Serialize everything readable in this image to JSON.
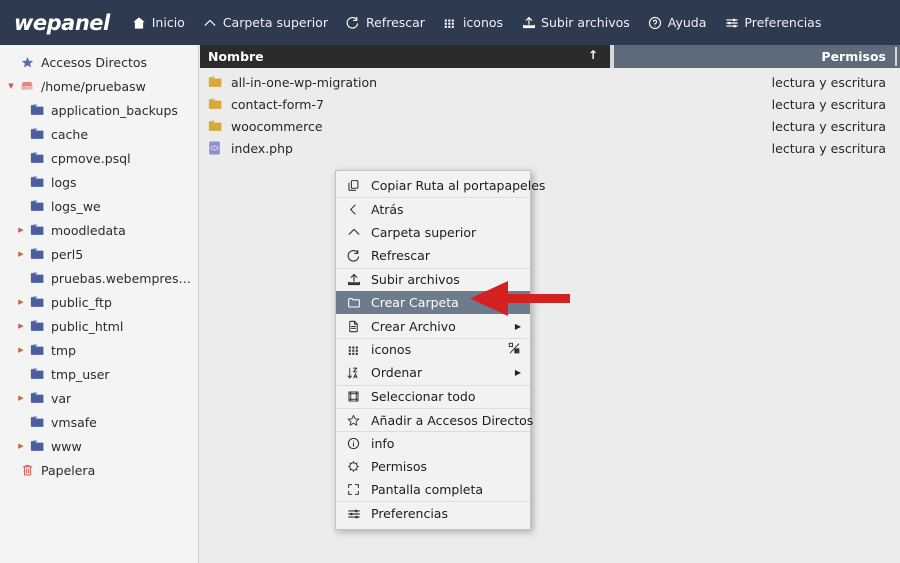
{
  "app": {
    "logo": "wepanel",
    "brand_color": "#2e3a4f",
    "accent_color": "#d05a4a"
  },
  "toolbar": {
    "items": [
      {
        "label": "Inicio",
        "icon": "home-icon"
      },
      {
        "label": "Carpeta superior",
        "icon": "chevron-up-icon"
      },
      {
        "label": "Refrescar",
        "icon": "refresh-icon"
      },
      {
        "label": "iconos",
        "icon": "grid-icon"
      },
      {
        "label": "Subir archivos",
        "icon": "upload-icon"
      },
      {
        "label": "Ayuda",
        "icon": "help-circle-icon"
      },
      {
        "label": "Preferencias",
        "icon": "sliders-icon"
      }
    ]
  },
  "sidebar": {
    "items": [
      {
        "label": "Accesos Directos",
        "icon": "star-icon",
        "depth": 0,
        "caret": "",
        "kind": "shortcuts"
      },
      {
        "label": "/home/pruebasw",
        "icon": "drive-icon",
        "depth": 0,
        "caret": "down",
        "kind": "root"
      },
      {
        "label": "application_backups",
        "icon": "folder-icon",
        "depth": 1,
        "caret": "",
        "kind": "folder"
      },
      {
        "label": "cache",
        "icon": "folder-icon",
        "depth": 1,
        "caret": "",
        "kind": "folder"
      },
      {
        "label": "cpmove.psql",
        "icon": "folder-icon",
        "depth": 1,
        "caret": "",
        "kind": "folder"
      },
      {
        "label": "logs",
        "icon": "folder-icon",
        "depth": 1,
        "caret": "",
        "kind": "folder"
      },
      {
        "label": "logs_we",
        "icon": "folder-icon",
        "depth": 1,
        "caret": "",
        "kind": "folder"
      },
      {
        "label": "moodledata",
        "icon": "folder-icon",
        "depth": 1,
        "caret": "right",
        "kind": "folder"
      },
      {
        "label": "perl5",
        "icon": "folder-icon",
        "depth": 1,
        "caret": "right",
        "kind": "folder"
      },
      {
        "label": "pruebas.webempresa.eu",
        "icon": "folder-icon",
        "depth": 1,
        "caret": "",
        "kind": "folder"
      },
      {
        "label": "public_ftp",
        "icon": "folder-icon",
        "depth": 1,
        "caret": "right",
        "kind": "folder"
      },
      {
        "label": "public_html",
        "icon": "folder-icon",
        "depth": 1,
        "caret": "right",
        "kind": "folder"
      },
      {
        "label": "tmp",
        "icon": "folder-icon",
        "depth": 1,
        "caret": "right",
        "kind": "folder"
      },
      {
        "label": "tmp_user",
        "icon": "folder-icon",
        "depth": 1,
        "caret": "",
        "kind": "folder"
      },
      {
        "label": "var",
        "icon": "folder-icon",
        "depth": 1,
        "caret": "right",
        "kind": "folder"
      },
      {
        "label": "vmsafe",
        "icon": "folder-icon",
        "depth": 1,
        "caret": "",
        "kind": "folder"
      },
      {
        "label": "www",
        "icon": "folder-icon",
        "depth": 1,
        "caret": "right",
        "kind": "folder"
      },
      {
        "label": "Papelera",
        "icon": "trash-icon",
        "depth": 0,
        "caret": "",
        "kind": "trash"
      }
    ]
  },
  "filelist": {
    "columns": {
      "name": "Nombre",
      "permissions": "Permisos"
    },
    "sort_indicator": "↑",
    "rows": [
      {
        "name": "all-in-one-wp-migration",
        "permissions": "lectura y escritura",
        "icon": "folder-icon",
        "type": "folder"
      },
      {
        "name": "contact-form-7",
        "permissions": "lectura y escritura",
        "icon": "folder-icon",
        "type": "folder"
      },
      {
        "name": "woocommerce",
        "permissions": "lectura y escritura",
        "icon": "folder-icon",
        "type": "folder"
      },
      {
        "name": "index.php",
        "permissions": "lectura y escritura",
        "icon": "php-file-icon",
        "type": "file"
      }
    ]
  },
  "context_menu": {
    "selected": "Crear Carpeta",
    "items": [
      {
        "label": "Copiar Ruta al portapapeles",
        "icon": "copy-icon",
        "submenu": false,
        "separator_above": false,
        "selected": false
      },
      {
        "label": "Atrás",
        "icon": "chevron-left-icon",
        "submenu": false,
        "separator_above": true,
        "selected": false
      },
      {
        "label": "Carpeta superior",
        "icon": "chevron-up-icon",
        "submenu": false,
        "separator_above": false,
        "selected": false
      },
      {
        "label": "Refrescar",
        "icon": "refresh-icon",
        "submenu": false,
        "separator_above": false,
        "selected": false
      },
      {
        "label": "Subir archivos",
        "icon": "upload-icon",
        "submenu": false,
        "separator_above": true,
        "selected": false
      },
      {
        "label": "Crear Carpeta",
        "icon": "folder-plus-icon",
        "submenu": false,
        "separator_above": false,
        "selected": true
      },
      {
        "label": "Crear Archivo",
        "icon": "file-icon",
        "submenu": true,
        "separator_above": false,
        "selected": false
      },
      {
        "label": "iconos",
        "icon": "grid-icon",
        "submenu": false,
        "separator_above": true,
        "selected": false,
        "trailing_icon": "view-toggle-icon"
      },
      {
        "label": "Ordenar",
        "icon": "sort-az-icon",
        "submenu": true,
        "separator_above": false,
        "selected": false
      },
      {
        "label": "Seleccionar todo",
        "icon": "select-all-icon",
        "submenu": false,
        "separator_above": true,
        "selected": false
      },
      {
        "label": "Añadir a Accesos Directos",
        "icon": "star-outline-icon",
        "submenu": false,
        "separator_above": true,
        "selected": false
      },
      {
        "label": "info",
        "icon": "info-icon",
        "submenu": false,
        "separator_above": true,
        "selected": false
      },
      {
        "label": "Permisos",
        "icon": "permissions-icon",
        "submenu": false,
        "separator_above": false,
        "selected": false
      },
      {
        "label": "Pantalla completa",
        "icon": "fullscreen-icon",
        "submenu": false,
        "separator_above": false,
        "selected": false
      },
      {
        "label": "Preferencias",
        "icon": "sliders-icon",
        "submenu": false,
        "separator_above": true,
        "selected": false
      }
    ]
  },
  "annotation": {
    "type": "arrow",
    "direction": "left",
    "color": "#d32020",
    "points_to": "Crear Carpeta"
  }
}
